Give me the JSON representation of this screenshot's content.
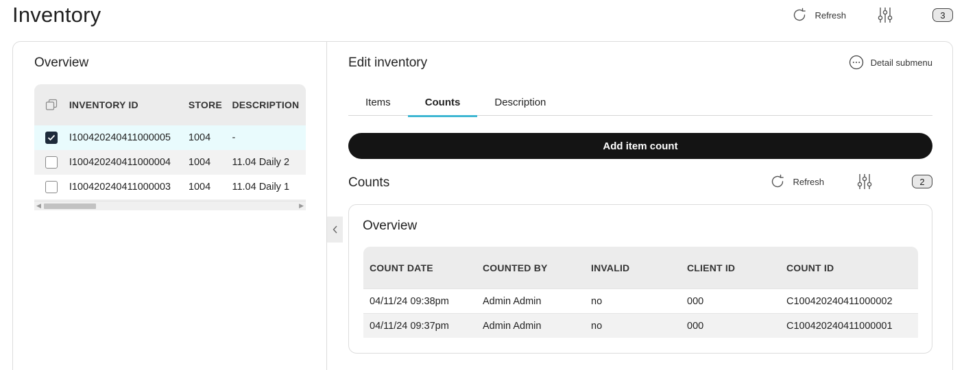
{
  "page": {
    "title": "Inventory"
  },
  "toolbar": {
    "refresh_label": "Refresh",
    "badge_count": "3"
  },
  "overview": {
    "title": "Overview",
    "columns": [
      "INVENTORY ID",
      "STORE",
      "DESCRIPTION"
    ],
    "rows": [
      {
        "id": "I100420240411000005",
        "store": "1004",
        "description": "-",
        "checked": true
      },
      {
        "id": "I100420240411000004",
        "store": "1004",
        "description": "11.04 Daily 2",
        "checked": false
      },
      {
        "id": "I100420240411000003",
        "store": "1004",
        "description": "11.04 Daily 1",
        "checked": false
      }
    ]
  },
  "edit": {
    "title": "Edit inventory",
    "detail_submenu_label": "Detail submenu",
    "tabs": [
      {
        "label": "Items",
        "active": false
      },
      {
        "label": "Counts",
        "active": true
      },
      {
        "label": "Description",
        "active": false
      }
    ],
    "add_button_label": "Add item count"
  },
  "counts": {
    "title": "Counts",
    "refresh_label": "Refresh",
    "badge_count": "2",
    "card_title": "Overview",
    "columns": [
      "COUNT DATE",
      "COUNTED BY",
      "INVALID",
      "CLIENT ID",
      "COUNT ID"
    ],
    "rows": [
      {
        "date": "04/11/24 09:38pm",
        "by": "Admin Admin",
        "invalid": "no",
        "client_id": "000",
        "count_id": "C100420240411000002"
      },
      {
        "date": "04/11/24 09:37pm",
        "by": "Admin Admin",
        "invalid": "no",
        "client_id": "000",
        "count_id": "C100420240411000001"
      }
    ]
  },
  "colors": {
    "accent": "#3fb7d3",
    "primary_button": "#141414",
    "selected_row": "#e9fbfd",
    "checkbox_checked": "#1d2a3a"
  }
}
